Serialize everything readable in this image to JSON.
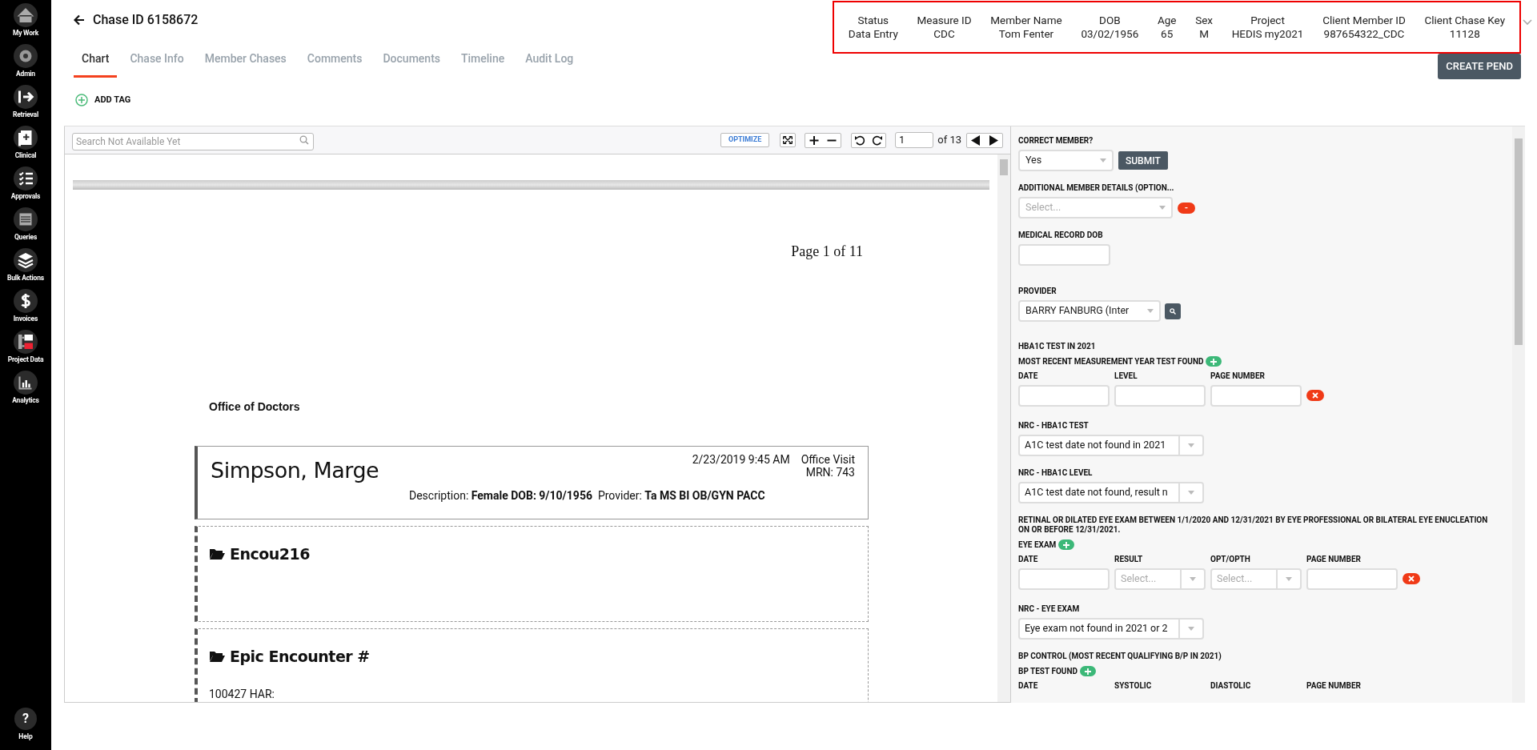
{
  "sidebar": {
    "items": [
      {
        "label": "My Work",
        "kind": "home"
      },
      {
        "label": "Admin",
        "kind": "gear"
      },
      {
        "label": "Retrieval",
        "kind": "arrow"
      },
      {
        "label": "Clinical",
        "kind": "clipboard"
      },
      {
        "label": "Approvals",
        "kind": "checklist"
      },
      {
        "label": "Queries",
        "kind": "list"
      },
      {
        "label": "Bulk Actions",
        "kind": "layers"
      },
      {
        "label": "Invoices",
        "kind": "dollar"
      },
      {
        "label": "Project Data",
        "kind": "tree"
      },
      {
        "label": "Analytics",
        "kind": "chart"
      }
    ],
    "help": {
      "label": "Help",
      "icon": "?"
    }
  },
  "header": {
    "title": "Chase ID 6158672"
  },
  "tabs": [
    {
      "label": "Chart",
      "selected": true
    },
    {
      "label": "Chase Info",
      "selected": false
    },
    {
      "label": "Member Chases",
      "selected": false
    },
    {
      "label": "Comments",
      "selected": false
    },
    {
      "label": "Documents",
      "selected": false
    },
    {
      "label": "Timeline",
      "selected": false
    },
    {
      "label": "Audit Log",
      "selected": false
    }
  ],
  "add_tag": "ADD TAG",
  "summary": [
    {
      "label": "Status",
      "value": "Data Entry"
    },
    {
      "label": "Measure ID",
      "value": "CDC"
    },
    {
      "label": "Member Name",
      "value": "Tom Fenter"
    },
    {
      "label": "DOB",
      "value": "03/02/1956"
    },
    {
      "label": "Age",
      "value": "65"
    },
    {
      "label": "Sex",
      "value": "M"
    },
    {
      "label": "Project",
      "value": "HEDIS my2021"
    },
    {
      "label": "Client Member ID",
      "value": "987654322_CDC"
    },
    {
      "label": "Client Chase Key",
      "value": "11128"
    }
  ],
  "create_pend": "CREATE PEND",
  "viewer": {
    "search": {
      "placeholder": "Search Not Available Yet"
    },
    "optimize": "OPTIMIZE",
    "page": "1",
    "page_total": "of 13",
    "document": {
      "page_label": "Page 1 of 11",
      "office": "Office of Doctors",
      "visit": {
        "name": "Simpson, Marge",
        "datetime": "2/23/2019 9:45 AM",
        "type": "Office Visit",
        "mrn": "MRN: 743",
        "description": "Description: **Female DOB: 9/10/1956**  Provider: **Ta MS BI OB/GYN PACC**"
      },
      "sections": [
        {
          "title": "Encou216"
        },
        {
          "title": "Epic Encounter #",
          "line": "100427 HAR:"
        }
      ]
    }
  },
  "form": [
    {
      "kind": "select_submit",
      "label": "CORRECT MEMBER?",
      "value": "Yes",
      "button": "SUBMIT"
    },
    {
      "kind": "select_remove",
      "label": "ADDITIONAL MEMBER DETAILS (OPTION...",
      "placeholder": "Select...",
      "remove": "-"
    },
    {
      "kind": "input",
      "label": "MEDICAL RECORD DOB"
    },
    {
      "kind": "select_search",
      "label": "PROVIDER",
      "value": "BARRY FANBURG (Inter"
    },
    {
      "kind": "group",
      "title": "HBA1C TEST IN 2021",
      "subtitle": "MOST RECENT MEASUREMENT YEAR TEST FOUND",
      "fields": [
        {
          "kind": "input",
          "label": "DATE"
        },
        {
          "kind": "input",
          "label": "LEVEL"
        },
        {
          "kind": "input",
          "label": "PAGE NUMBER"
        }
      ],
      "removable": true
    },
    {
      "kind": "combo",
      "label": "NRC - HBA1C TEST",
      "value": "A1C test date not found in 2021"
    },
    {
      "kind": "combo",
      "label": "NRC - HBA1C LEVEL",
      "value": "A1C test date not found, result n"
    },
    {
      "kind": "group",
      "title": "RETINAL OR DILATED EYE EXAM BETWEEN 1/1/2020 AND 12/31/2021 BY EYE PROFESSIONAL OR BILATERAL EYE ENUCLEATION ON OR BEFORE 12/31/2021.",
      "subtitle": "EYE EXAM",
      "fields": [
        {
          "kind": "input",
          "label": "DATE"
        },
        {
          "kind": "select",
          "label": "RESULT",
          "placeholder": "Select..."
        },
        {
          "kind": "select",
          "label": "OPT/OPTH",
          "placeholder": "Select..."
        },
        {
          "kind": "input",
          "label": "PAGE NUMBER"
        }
      ],
      "removable": true
    },
    {
      "kind": "combo",
      "label": "NRC - EYE EXAM",
      "value": "Eye exam not found in 2021 or 2"
    },
    {
      "kind": "group",
      "title": "BP CONTROL (MOST RECENT QUALIFYING B/P IN 2021)",
      "subtitle": "BP TEST FOUND",
      "fields": [
        {
          "kind": "label",
          "label": "DATE"
        },
        {
          "kind": "label",
          "label": "SYSTOLIC"
        },
        {
          "kind": "label",
          "label": "DIASTOLIC"
        },
        {
          "kind": "label",
          "label": "PAGE NUMBER"
        }
      ]
    }
  ]
}
